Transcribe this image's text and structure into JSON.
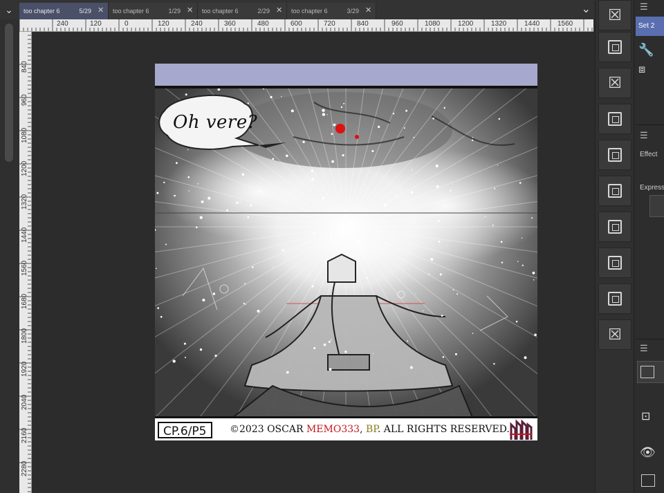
{
  "tabs": [
    {
      "name": "too chapter 6",
      "pages": "5/29",
      "active": true
    },
    {
      "name": "too chapter 6",
      "pages": "1/29",
      "active": false
    },
    {
      "name": "too chapter 6",
      "pages": "2/29",
      "active": false
    },
    {
      "name": "too chapter 6",
      "pages": "3/29",
      "active": false
    }
  ],
  "ruler": {
    "horizontal": [
      "240",
      "120",
      "0",
      "120",
      "240",
      "360",
      "480",
      "600",
      "720",
      "840",
      "960",
      "1080",
      "1200",
      "1320",
      "1440",
      "1560"
    ],
    "vertical": [
      "840",
      "960",
      "1080",
      "1200",
      "1320",
      "1440",
      "1560",
      "1680",
      "1800",
      "1920",
      "2040",
      "2160",
      "2280"
    ]
  },
  "page": {
    "speech_bubble": "Oh vere?",
    "chapter_label": "CP.6/P5",
    "copyright_prefix": "©2023 OSCAR ",
    "copyright_red": "MEMO333",
    "copyright_sep": ", ",
    "copyright_olive": "BP",
    "copyright_suffix": ". ALL RIGHTS RESERVED."
  },
  "right_panel": {
    "set_name": "Set 2",
    "effect_label": "Effect",
    "expression_label": "Expressi"
  },
  "colors": {
    "page_header": "#a7a8cd",
    "active_tab": "#4a5068",
    "selected_set": "#5a6fb0"
  }
}
